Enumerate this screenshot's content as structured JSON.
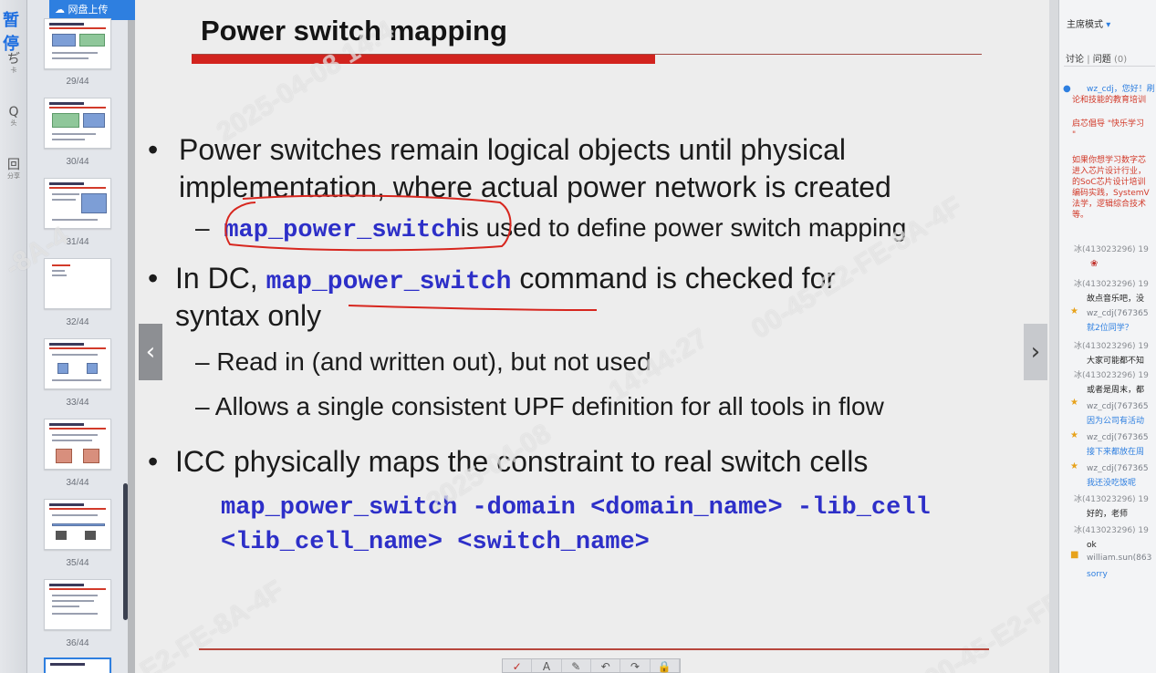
{
  "toolbar": {
    "pause_label": "暂停",
    "tools": [
      {
        "glyph": "ぢ",
        "label": "卡"
      },
      {
        "glyph": "Q",
        "label": "头"
      },
      {
        "glyph": "回",
        "label": "分享"
      }
    ]
  },
  "thumbnails": {
    "upload_label": "网盘上传",
    "labels": [
      "29/44",
      "30/44",
      "31/44",
      "32/44",
      "33/44",
      "34/44",
      "35/44",
      "36/44"
    ]
  },
  "slide": {
    "title": "Power switch mapping",
    "bullet1_line1": "Power switches remain logical objects until physical",
    "bullet1_line2": "implementation, where actual power network is created",
    "sub1_dash": "–",
    "sub1_code": "map_power_switch",
    "sub1_text": "is used to define power switch mapping",
    "bullet2_prefix": "In DC,",
    "bullet2_code": "map_power_switch",
    "bullet2_suffix": "command is checked for",
    "bullet2_line2": "syntax only",
    "sub2": "– Read in (and written out), but not used",
    "sub3": "– Allows a single consistent UPF definition for all tools in flow",
    "bullet3": "ICC physically maps the constraint to real switch cells",
    "code_line1": "map_power_switch -domain <domain_name> -lib_cell",
    "code_line2": "<lib_cell_name> <switch_name>",
    "bullet_glyph": "•"
  },
  "watermarks": [
    "2025-04-08 14:4",
    "00-45-E2-FE-8A-4F",
    "14:44:27",
    "2025-04-08",
    "E2-FE-8A-4F",
    "-8A-4",
    "00-45-E2-FE-"
  ],
  "nav": {
    "prev": "‹",
    "next": "›"
  },
  "pen_tools": [
    "✓",
    "A",
    "✎",
    "↶",
    "↷",
    "🔒"
  ],
  "chat": {
    "mode_label": "主席模式",
    "mode_arrow": "▾",
    "tab_discuss": "讨论",
    "tab_sep": "|",
    "tab_question": "问题",
    "tab_question_count": "(0)",
    "messages": [
      {
        "kind": "blue",
        "text": "wz_cdj，您好！刷"
      },
      {
        "kind": "red",
        "text": "论和技能的教育培训"
      },
      {
        "kind": "red",
        "text": "启芯倡导 \"快乐学习"
      },
      {
        "kind": "red",
        "text": "\""
      },
      {
        "kind": "red",
        "text": "如果你想学习数字芯"
      },
      {
        "kind": "red",
        "text": "进入芯片设计行业，"
      },
      {
        "kind": "red",
        "text": "的SoC芯片设计培训"
      },
      {
        "kind": "red",
        "text": "编码实践，SystemV"
      },
      {
        "kind": "red",
        "text": "法学，逻辑综合技术"
      },
      {
        "kind": "red",
        "text": "等。"
      },
      {
        "kind": "meta",
        "text": "冰(413023296) 19"
      },
      {
        "kind": "meta",
        "text": "冰(413023296) 19"
      },
      {
        "kind": "body",
        "text": "故点音乐吧，没"
      },
      {
        "kind": "name",
        "text": "wz_cdj(767365"
      },
      {
        "kind": "blue",
        "text": "就2位同学？"
      },
      {
        "kind": "meta",
        "text": "冰(413023296) 19"
      },
      {
        "kind": "body",
        "text": "大家可能都不知"
      },
      {
        "kind": "meta",
        "text": "冰(413023296) 19"
      },
      {
        "kind": "body",
        "text": "或者是周末，都"
      },
      {
        "kind": "name",
        "text": "wz_cdj(767365"
      },
      {
        "kind": "blue",
        "text": "因为公司有活动"
      },
      {
        "kind": "name",
        "text": "wz_cdj(767365"
      },
      {
        "kind": "blue",
        "text": "接下来都放在周"
      },
      {
        "kind": "name",
        "text": "wz_cdj(767365"
      },
      {
        "kind": "blue",
        "text": "我还没吃饭呢"
      },
      {
        "kind": "meta",
        "text": "冰(413023296) 19"
      },
      {
        "kind": "body",
        "text": "好的，老师"
      },
      {
        "kind": "meta",
        "text": "冰(413023296) 19"
      },
      {
        "kind": "body",
        "text": "ok"
      },
      {
        "kind": "name",
        "text": "william.sun(863"
      },
      {
        "kind": "blue",
        "text": "sorry"
      }
    ]
  }
}
